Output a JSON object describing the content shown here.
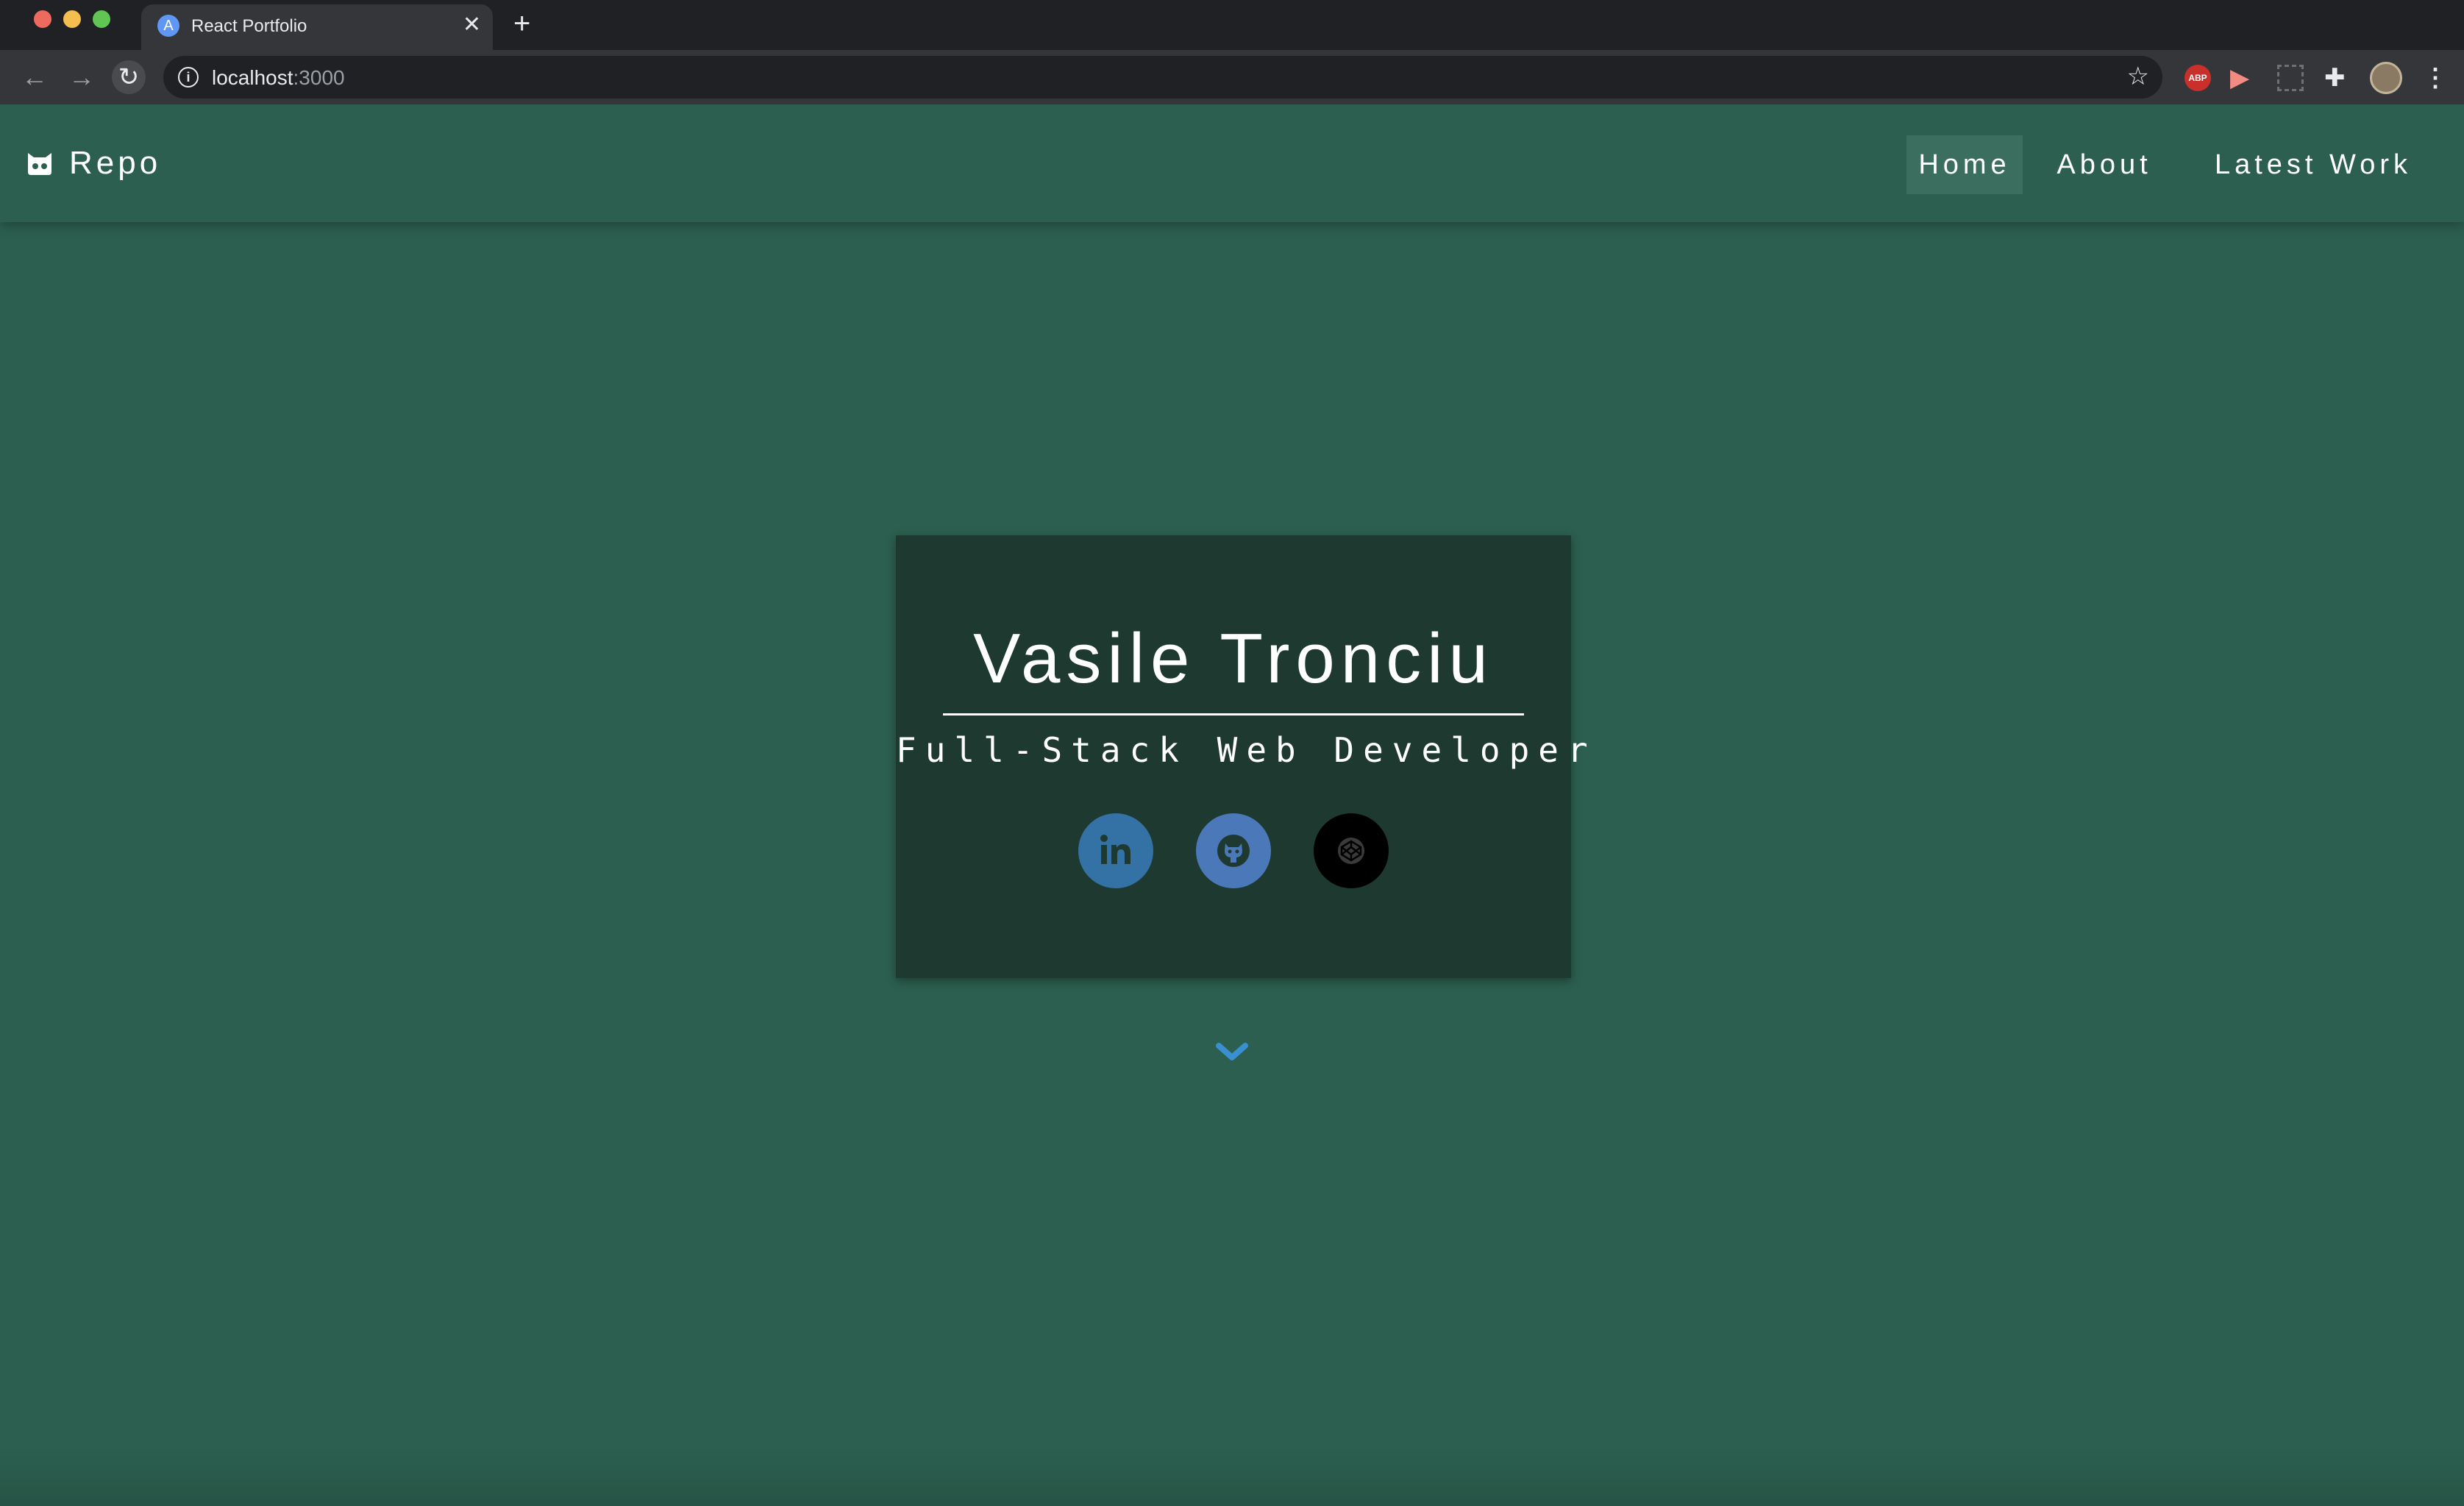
{
  "browser": {
    "tab": {
      "title": "React Portfolio",
      "favicon_letter": "A",
      "close_glyph": "✕"
    },
    "new_tab_glyph": "+",
    "address_bar": {
      "host": "localhost",
      "port": ":3000"
    },
    "extensions": [
      "adblock-plus-icon",
      "cast-icon",
      "screen-capture-icon",
      "extensions-puzzle-icon",
      "profile-avatar",
      "more-menu-icon"
    ],
    "abp_label": "ABP"
  },
  "navbar": {
    "brand": "Repo",
    "links": [
      "Home",
      "About",
      "Latest Work"
    ],
    "active_link": "Home"
  },
  "hero": {
    "name": "Vasile Tronciu",
    "role": "Full-Stack Web Developer",
    "social": [
      {
        "name": "linkedin",
        "label": "in"
      },
      {
        "name": "github"
      },
      {
        "name": "codepen"
      }
    ]
  },
  "colors": {
    "page_background": "#2c5f4f",
    "card_background": "#1e3a30",
    "nav_active_background": "#3b6e5e",
    "linkedin": "#3471a4",
    "github": "#4b78b8",
    "codepen": "#000000",
    "scroll_arrow": "#3a8fd0"
  }
}
